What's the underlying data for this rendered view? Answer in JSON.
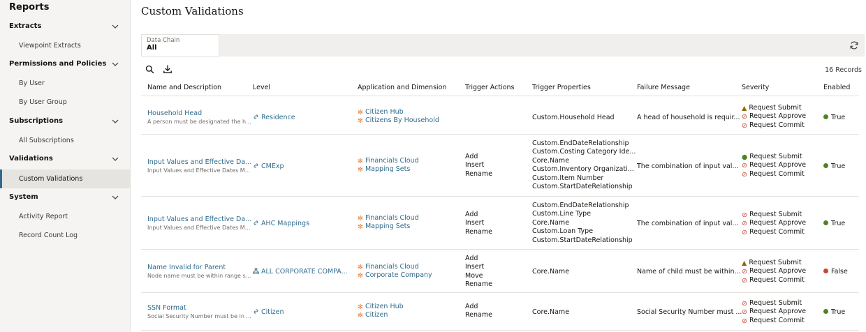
{
  "sidebar": {
    "title": "Reports",
    "sections": [
      {
        "label": "Extracts",
        "items": [
          "Viewpoint Extracts"
        ]
      },
      {
        "label": "Permissions and Policies",
        "items": [
          "By User",
          "By User Group"
        ]
      },
      {
        "label": "Subscriptions",
        "items": [
          "All Subscriptions"
        ]
      },
      {
        "label": "Validations",
        "items": [
          "Custom Validations"
        ]
      },
      {
        "label": "System",
        "items": [
          "Activity Report",
          "Record Count Log"
        ]
      }
    ],
    "active_item": "Custom Validations"
  },
  "page": {
    "title": "Custom Validations",
    "filter": {
      "caption": "Data Chain",
      "value": "All"
    },
    "record_count": "16 Records"
  },
  "table": {
    "headers": [
      "Name and Description",
      "Level",
      "Application and Dimension",
      "Trigger Actions",
      "Trigger Properties",
      "Failure Message",
      "Severity",
      "Enabled"
    ],
    "rows": [
      {
        "name": "Household Head",
        "description": "A person must be designated the h...",
        "level": "Residence",
        "level_icon": "link-icon",
        "applications": [
          "Citizen Hub",
          "Citizens By Household"
        ],
        "trigger_actions": [],
        "trigger_properties": [
          "Custom.Household Head"
        ],
        "failure_message": "A head of household is requir...",
        "severity": [
          {
            "status": "warning",
            "label": "Request Submit"
          },
          {
            "status": "error",
            "label": "Request Approve"
          },
          {
            "status": "error",
            "label": "Request Commit"
          }
        ],
        "enabled": "True"
      },
      {
        "name": "Input Values and Effective Da...",
        "description": "Input Values and Effective Dates M...",
        "level": "CMExp",
        "level_icon": "link-icon",
        "applications": [
          "Financials Cloud",
          "Mapping Sets"
        ],
        "trigger_actions": [
          "Add",
          "Insert",
          "Rename"
        ],
        "trigger_properties": [
          "Custom.EndDateRelationship",
          "Custom.Costing Category Ide...",
          "Core.Name",
          "Custom.Inventory Organizati...",
          "Custom.Item Number",
          "Custom.StartDateRelationship"
        ],
        "failure_message": "The combination of input val...",
        "severity": [
          {
            "status": "ok",
            "label": "Request Submit"
          },
          {
            "status": "error",
            "label": "Request Approve"
          },
          {
            "status": "error",
            "label": "Request Commit"
          }
        ],
        "enabled": "True"
      },
      {
        "name": "Input Values and Effective Da...",
        "description": "Input Values and Effective Dates M...",
        "level": "AHC Mappings",
        "level_icon": "link-icon",
        "applications": [
          "Financials Cloud",
          "Mapping Sets"
        ],
        "trigger_actions": [
          "Add",
          "Insert",
          "Rename"
        ],
        "trigger_properties": [
          "Custom.EndDateRelationship",
          "Custom.Line Type",
          "Core.Name",
          "Custom.Loan Type",
          "Custom.StartDateRelationship"
        ],
        "failure_message": "The combination of input val...",
        "severity": [
          {
            "status": "error",
            "label": "Request Submit"
          },
          {
            "status": "error",
            "label": "Request Approve"
          },
          {
            "status": "error",
            "label": "Request Commit"
          }
        ],
        "enabled": "True"
      },
      {
        "name": "Name Invalid for Parent",
        "description": "Node name must be within range s...",
        "level": "ALL CORPORATE COMPA...",
        "level_icon": "hierarchy-icon",
        "applications": [
          "Financials Cloud",
          "Corporate Company"
        ],
        "trigger_actions": [
          "Add",
          "Insert",
          "Move",
          "Rename"
        ],
        "trigger_properties": [
          "Core.Name"
        ],
        "failure_message": "Name of child must be within...",
        "severity": [
          {
            "status": "warning",
            "label": "Request Submit"
          },
          {
            "status": "error",
            "label": "Request Approve"
          },
          {
            "status": "error",
            "label": "Request Commit"
          }
        ],
        "enabled": "False"
      },
      {
        "name": "SSN Format",
        "description": "Social Security Number must be in ...",
        "level": "Citizen",
        "level_icon": "link-icon",
        "applications": [
          "Citizen Hub",
          "Citizen"
        ],
        "trigger_actions": [
          "Add",
          "Rename"
        ],
        "trigger_properties": [
          "Core.Name"
        ],
        "failure_message": "Social Security Number must ...",
        "severity": [
          {
            "status": "error",
            "label": "Request Submit"
          },
          {
            "status": "error",
            "label": "Request Approve"
          },
          {
            "status": "error",
            "label": "Request Commit"
          }
        ],
        "enabled": "True"
      }
    ]
  },
  "colors": {
    "link": "#2f6a8e",
    "ok": "#508223",
    "error": "#c74634",
    "warning": "#8a6a10",
    "app_icon": "#e07d3a"
  }
}
